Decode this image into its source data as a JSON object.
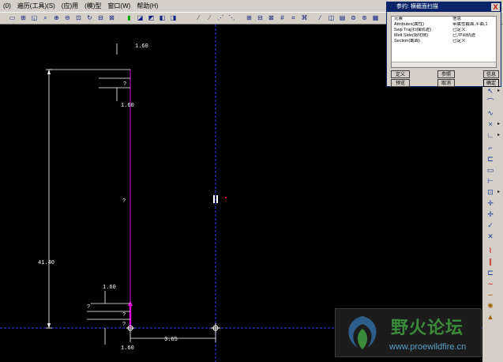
{
  "menubar": {
    "items": [
      "(0)",
      "遍历(工具)(S)",
      "(应)用",
      "(模)型",
      "窗口(W)",
      "帮助(H)"
    ]
  },
  "toolbar": {
    "icons": [
      "new-icon",
      "open-icon",
      "save-icon",
      "print-icon",
      "zoom-in-icon",
      "zoom-out-icon",
      "refit-icon",
      "repaint-icon",
      "orient-icon",
      "view-icon",
      "layers-icon",
      "datum-plane-icon",
      "datum-axis-icon",
      "datum-point-icon",
      "csys-icon",
      "sketch-icon",
      "grid-icon",
      "display-icon",
      "shade-icon",
      "hidden-line-icon"
    ]
  },
  "right_toolbar": {
    "icons": [
      "select-icon",
      "line-icon",
      "arc-icon",
      "circle-icon",
      "rectangle-icon",
      "fillet-icon",
      "spline-icon",
      "point-icon",
      "dimension-icon",
      "modify-icon",
      "constraint-icon",
      "text-icon",
      "palette-icon",
      "done-icon",
      "cancel-icon",
      "trim-icon",
      "mirror-icon",
      "offset-icon",
      "use-edge-icon",
      "thicken-icon",
      "divide-icon"
    ]
  },
  "dialog": {
    "title": "参约: 横截面扫描",
    "close": "X",
    "rows": [
      {
        "name": "元素",
        "info": "信息"
      },
      {
        "name": "Attributes(属性)",
        "info": "带属性截面,平面,1"
      },
      {
        "name": "Swp Traj(扫描轨迹)",
        "info": "已定义"
      },
      {
        "name": "Melt Side(熔化侧)",
        "info": "已,中间轨迹"
      },
      {
        "name": "Section(截面)",
        "info": "已定义"
      }
    ],
    "buttons": {
      "define": "定义",
      "refs": "参照",
      "info": "信息",
      "preview": "预览",
      "cancel": "取消",
      "ok": "确定"
    }
  },
  "dimensions": {
    "top_width": "1.60",
    "top_gap": "1.60",
    "mid": "?",
    "left_height": "41.40",
    "bottom_a": "1.60",
    "bottom_gap": "1.60",
    "bottom_width": "3.65",
    "q1": "?",
    "q2": "?",
    "q3": "?",
    "q4": "?"
  },
  "watermark": {
    "title": "野火论坛",
    "url": "www.proewildfire.cn"
  },
  "colors": {
    "canvas": "#000000",
    "sketch": "#ffffff",
    "magenta": "#e000e0",
    "centerline": "#3a3aff"
  }
}
